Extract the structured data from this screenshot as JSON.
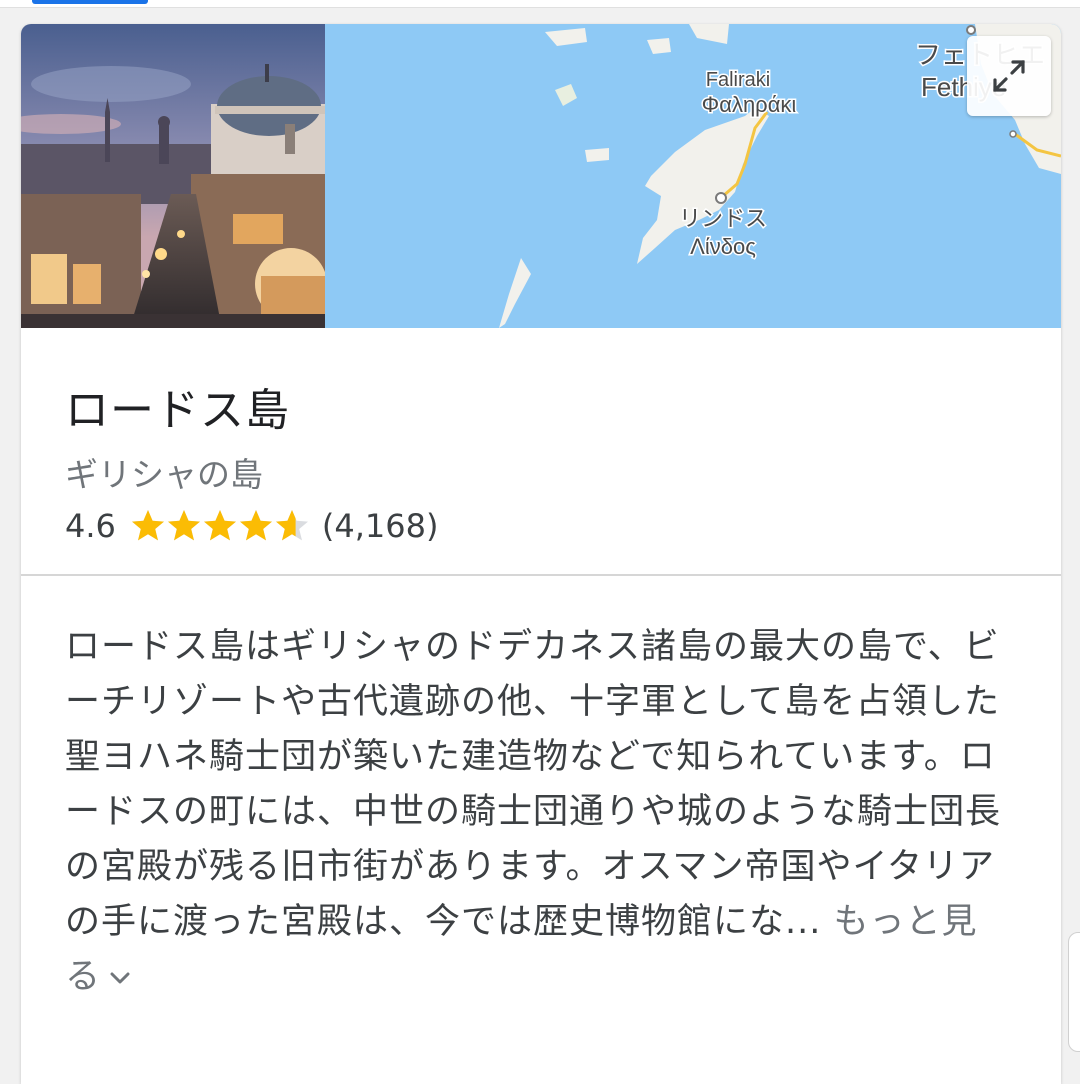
{
  "place": {
    "title": "ロードス島",
    "subtitle": "ギリシャの島",
    "rating": "4.6",
    "rating_value": 4.6,
    "review_count": "(4,168)",
    "description": "ロードス島はギリシャのドデカネス諸島の最大の島で、ビーチリゾートや古代遺跡の他、十字軍として島を占領した聖ヨハネ騎士団が築いた建造物などで知られています。ロードスの町には、中世の騎士団通りや城のような騎士団長の宮殿が残る旧市街があります。オスマン帝国やイタリアの手に渡った宮殿は、今では歴史博物館にな...",
    "more_label": "もっと見る"
  },
  "map": {
    "labels": {
      "faliraki_en": "Faliraki",
      "faliraki_gr": "Φαληράκι",
      "lindos_jp": "リンドス",
      "lindos_gr": "Λίνδος",
      "fethiye_jp": "フェトヒエ",
      "fethiye_en": "Fethiye"
    }
  },
  "icons": {
    "expand": "expand-arrows-icon",
    "chevron": "chevron-down-icon",
    "star": "star-icon"
  },
  "colors": {
    "star": "#fbbc04",
    "star_empty": "#dadce0",
    "sea": "#8ec9f5",
    "land": "#f2f1ec",
    "road": "#f4c542",
    "accent": "#1a73e8"
  }
}
